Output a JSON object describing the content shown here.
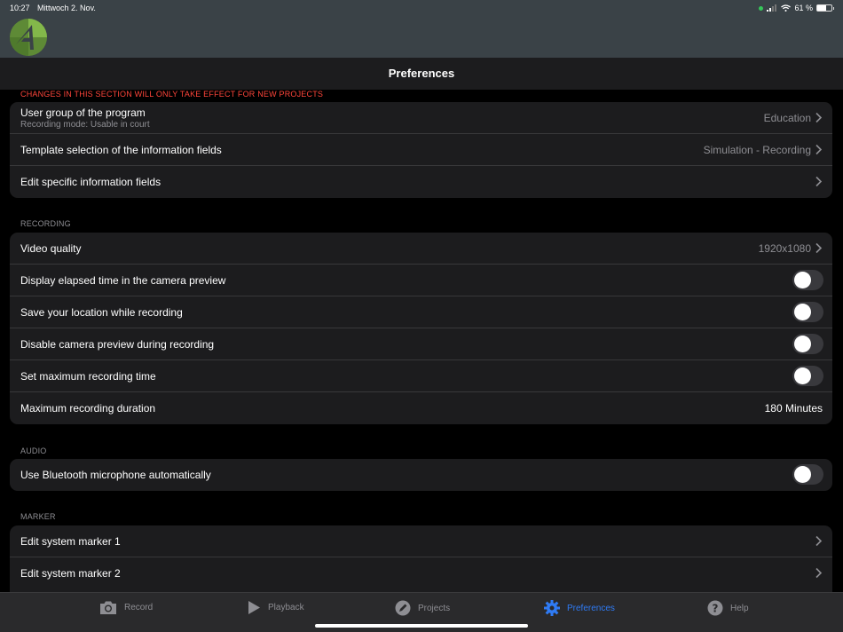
{
  "status_bar": {
    "time": "10:27",
    "date": "Mittwoch 2. Nov.",
    "battery": "61 %",
    "battery_level": 0.61
  },
  "nav": {
    "title": "Preferences"
  },
  "sections": {
    "project": {
      "header": "CHANGES IN THIS SECTION WILL ONLY TAKE EFFECT FOR NEW PROJECTS",
      "user_group": {
        "label": "User group of the program",
        "subtitle": "Recording mode: Usable in court",
        "value": "Education"
      },
      "template": {
        "label": "Template selection of the information fields",
        "value": "Simulation - Recording"
      },
      "edit_fields": {
        "label": "Edit specific information fields"
      }
    },
    "recording": {
      "header": "RECORDING",
      "video_quality": {
        "label": "Video quality",
        "value": "1920x1080"
      },
      "elapsed_time": {
        "label": "Display elapsed time in the camera preview",
        "on": false
      },
      "save_location": {
        "label": "Save your location while recording",
        "on": false
      },
      "disable_preview": {
        "label": "Disable camera preview during recording",
        "on": false
      },
      "max_time": {
        "label": "Set maximum recording time",
        "on": false
      },
      "max_duration": {
        "label": "Maximum recording duration",
        "value": "180 Minutes"
      }
    },
    "audio": {
      "header": "AUDIO",
      "bluetooth": {
        "label": "Use Bluetooth microphone automatically",
        "on": false
      }
    },
    "marker": {
      "header": "MARKER",
      "marker1": {
        "label": "Edit system marker 1"
      },
      "marker2": {
        "label": "Edit system marker 2"
      }
    }
  },
  "tabs": {
    "record": {
      "label": "Record",
      "icon": "camera-icon"
    },
    "playback": {
      "label": "Playback",
      "icon": "play-icon"
    },
    "projects": {
      "label": "Projects",
      "icon": "pencil-icon"
    },
    "preferences": {
      "label": "Preferences",
      "icon": "gear-icon",
      "active": true
    },
    "help": {
      "label": "Help",
      "icon": "help-icon"
    }
  },
  "colors": {
    "accent": "#2f7bf5",
    "warning": "#ff453a",
    "header_bg": "#3a4247",
    "logo_green": "#6a9e3a"
  }
}
